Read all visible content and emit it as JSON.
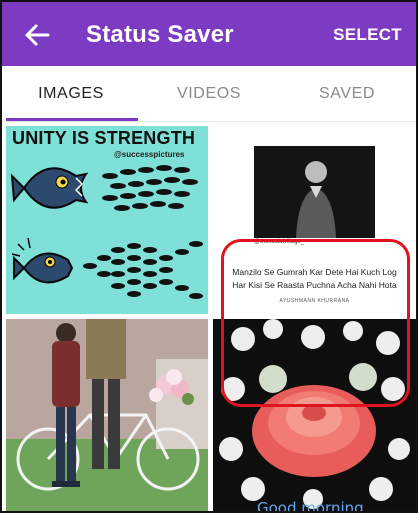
{
  "appbar": {
    "title": "Status Saver",
    "select_label": "SELECT"
  },
  "tabs": [
    {
      "label": "IMAGES",
      "active": true
    },
    {
      "label": "VIDEOS",
      "active": false
    },
    {
      "label": "SAVED",
      "active": false
    }
  ],
  "grid": {
    "tile1": {
      "headline": "UNITY IS STRENGTH",
      "watermark": "@successpictures"
    },
    "tile2": {
      "handle": "@thesocialvillage_",
      "quote_line1": "Manzilo Se Gumrah Kar Dete Hai Kuch Log",
      "quote_line2": "Har Kisi Se Raasta Puchna Acha Nahi Hota",
      "author": "AYUSHMANN KHURRANA",
      "selected": true
    },
    "tile4": {
      "caption": "Good morning"
    }
  },
  "colors": {
    "primary": "#7d3bc4",
    "highlight": "#e0141e",
    "accent_text": "#67a6f0"
  },
  "icons": {
    "back": "arrow-left-icon"
  }
}
